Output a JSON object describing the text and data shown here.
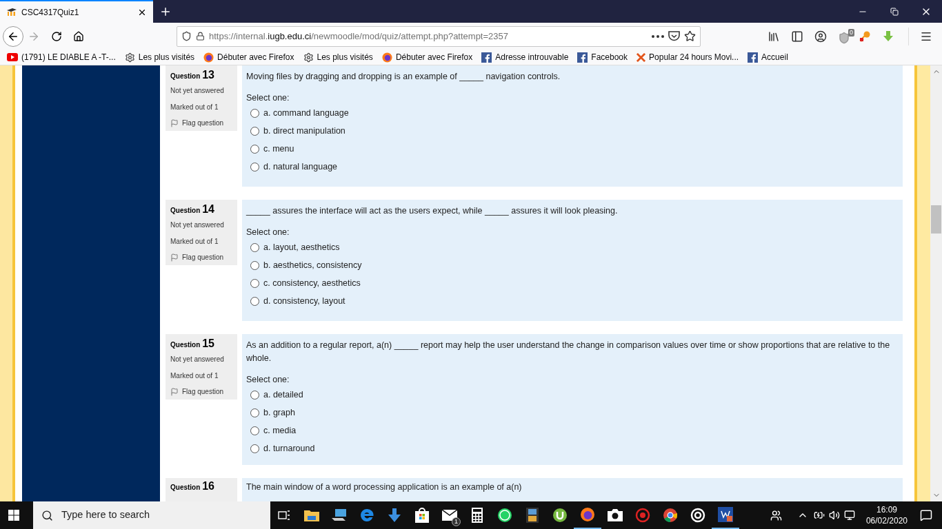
{
  "browser": {
    "tab": {
      "title": "CSC4317Quiz1",
      "selected": true
    },
    "url": {
      "scheme": "https://internal.",
      "domain": "iugb.edu.ci",
      "path": "/newmoodle/mod/quiz/attempt.php?attempt=2357"
    },
    "addon_badge": "0",
    "bookmarks": [
      {
        "kind": "youtube",
        "label": "(1791) LE DIABLE A -T-..."
      },
      {
        "kind": "gear",
        "label": "Les plus visités"
      },
      {
        "kind": "firefox",
        "label": "Débuter avec Firefox"
      },
      {
        "kind": "gear",
        "label": "Les plus visités"
      },
      {
        "kind": "firefox",
        "label": "Débuter avec Firefox"
      },
      {
        "kind": "facebook",
        "label": "Adresse introuvable"
      },
      {
        "kind": "facebook",
        "label": "Facebook"
      },
      {
        "kind": "x",
        "label": "Popular 24 hours Movi..."
      },
      {
        "kind": "facebook",
        "label": "Accueil"
      }
    ]
  },
  "questions": [
    {
      "label": "Question",
      "number": "13",
      "status": "Not yet answered",
      "marks": "Marked out of 1",
      "flag": "Flag question",
      "prompt": "Moving files by dragging and dropping is an example of _____ navigation controls.",
      "select_label": "Select one:",
      "options": [
        {
          "label": "a. command language",
          "selected": false
        },
        {
          "label": "b. direct manipulation",
          "selected": false
        },
        {
          "label": "c. menu",
          "selected": false
        },
        {
          "label": "d. natural language",
          "selected": false
        }
      ]
    },
    {
      "label": "Question",
      "number": "14",
      "status": "Not yet answered",
      "marks": "Marked out of 1",
      "flag": "Flag question",
      "prompt": "_____ assures the interface will act as the users expect, while _____ assures it will look pleasing.",
      "select_label": "Select one:",
      "options": [
        {
          "label": "a. layout, aesthetics",
          "selected": false
        },
        {
          "label": "b. aesthetics, consistency",
          "selected": false
        },
        {
          "label": "c. consistency, aesthetics",
          "selected": false
        },
        {
          "label": "d. consistency, layout",
          "selected": false
        }
      ]
    },
    {
      "label": "Question",
      "number": "15",
      "status": "Not yet answered",
      "marks": "Marked out of 1",
      "flag": "Flag question",
      "prompt": "As an addition to a regular report, a(n) _____ report may help the user understand the change in comparison values over time or show proportions that are relative to the whole.",
      "select_label": "Select one:",
      "options": [
        {
          "label": "a. detailed",
          "selected": false
        },
        {
          "label": "b. graph",
          "selected": false
        },
        {
          "label": "c. media",
          "selected": false
        },
        {
          "label": "d. turnaround",
          "selected": false
        }
      ]
    }
  ],
  "partial_question": {
    "label": "Question",
    "number": "16",
    "prompt": "The main window of a word processing application is an example of a(n)"
  },
  "taskbar": {
    "search_placeholder": "Type here to search",
    "mail_badge": "1",
    "time": "16:09",
    "date": "06/02/2020"
  }
}
